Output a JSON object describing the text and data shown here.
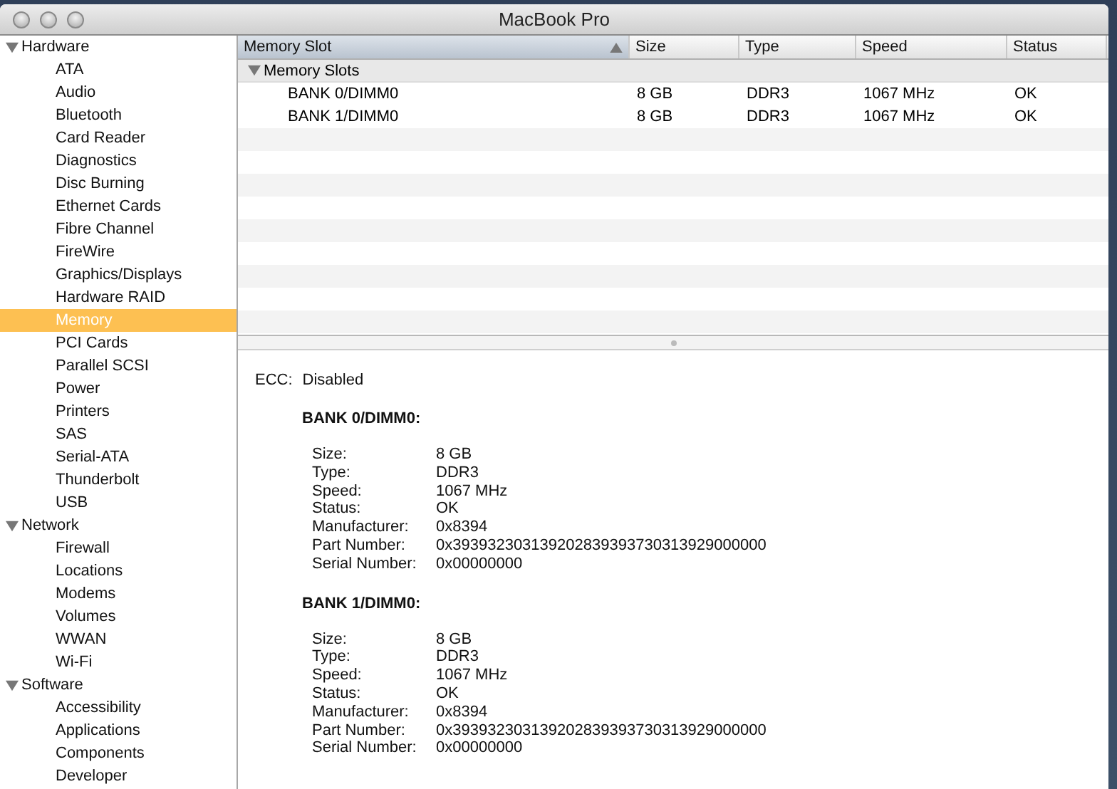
{
  "window": {
    "title": "MacBook Pro"
  },
  "sidebar": {
    "groups": [
      {
        "label": "Hardware",
        "expanded": true,
        "children": [
          {
            "label": "ATA",
            "selected": false
          },
          {
            "label": "Audio",
            "selected": false
          },
          {
            "label": "Bluetooth",
            "selected": false
          },
          {
            "label": "Card Reader",
            "selected": false
          },
          {
            "label": "Diagnostics",
            "selected": false
          },
          {
            "label": "Disc Burning",
            "selected": false
          },
          {
            "label": "Ethernet Cards",
            "selected": false
          },
          {
            "label": "Fibre Channel",
            "selected": false
          },
          {
            "label": "FireWire",
            "selected": false
          },
          {
            "label": "Graphics/Displays",
            "selected": false
          },
          {
            "label": "Hardware RAID",
            "selected": false
          },
          {
            "label": "Memory",
            "selected": true
          },
          {
            "label": "PCI Cards",
            "selected": false
          },
          {
            "label": "Parallel SCSI",
            "selected": false
          },
          {
            "label": "Power",
            "selected": false
          },
          {
            "label": "Printers",
            "selected": false
          },
          {
            "label": "SAS",
            "selected": false
          },
          {
            "label": "Serial-ATA",
            "selected": false
          },
          {
            "label": "Thunderbolt",
            "selected": false
          },
          {
            "label": "USB",
            "selected": false
          }
        ]
      },
      {
        "label": "Network",
        "expanded": true,
        "children": [
          {
            "label": "Firewall",
            "selected": false
          },
          {
            "label": "Locations",
            "selected": false
          },
          {
            "label": "Modems",
            "selected": false
          },
          {
            "label": "Volumes",
            "selected": false
          },
          {
            "label": "WWAN",
            "selected": false
          },
          {
            "label": "Wi-Fi",
            "selected": false
          }
        ]
      },
      {
        "label": "Software",
        "expanded": true,
        "children": [
          {
            "label": "Accessibility",
            "selected": false
          },
          {
            "label": "Applications",
            "selected": false
          },
          {
            "label": "Components",
            "selected": false
          },
          {
            "label": "Developer",
            "selected": false
          }
        ]
      }
    ]
  },
  "table": {
    "columns": [
      {
        "label": "Memory Slot",
        "sorted": true
      },
      {
        "label": "Size",
        "sorted": false
      },
      {
        "label": "Type",
        "sorted": false
      },
      {
        "label": "Speed",
        "sorted": false
      },
      {
        "label": "Status",
        "sorted": false
      }
    ],
    "groups": [
      {
        "label": "Memory Slots",
        "expanded": true,
        "rows": [
          {
            "cells": [
              "BANK 0/DIMM0",
              "8 GB",
              "DDR3",
              "1067 MHz",
              "OK"
            ]
          },
          {
            "cells": [
              "BANK 1/DIMM0",
              "8 GB",
              "DDR3",
              "1067 MHz",
              "OK"
            ]
          }
        ]
      }
    ]
  },
  "detail": {
    "ecc": {
      "label": "ECC:",
      "value": "Disabled"
    },
    "banks": [
      {
        "title": "BANK 0/DIMM0:",
        "fields": [
          {
            "label": "Size:",
            "value": "8 GB"
          },
          {
            "label": "Type:",
            "value": "DDR3"
          },
          {
            "label": "Speed:",
            "value": "1067 MHz"
          },
          {
            "label": "Status:",
            "value": "OK"
          },
          {
            "label": "Manufacturer:",
            "value": "0x8394"
          },
          {
            "label": "Part Number:",
            "value": "0x393932303139202839393730313929000000"
          },
          {
            "label": "Serial Number:",
            "value": "0x00000000"
          }
        ]
      },
      {
        "title": "BANK 1/DIMM0:",
        "fields": [
          {
            "label": "Size:",
            "value": "8 GB"
          },
          {
            "label": "Type:",
            "value": "DDR3"
          },
          {
            "label": "Speed:",
            "value": "1067 MHz"
          },
          {
            "label": "Status:",
            "value": "OK"
          },
          {
            "label": "Manufacturer:",
            "value": "0x8394"
          },
          {
            "label": "Part Number:",
            "value": "0x393932303139202839393730313929000000"
          },
          {
            "label": "Serial Number:",
            "value": "0x00000000"
          }
        ]
      }
    ]
  }
}
